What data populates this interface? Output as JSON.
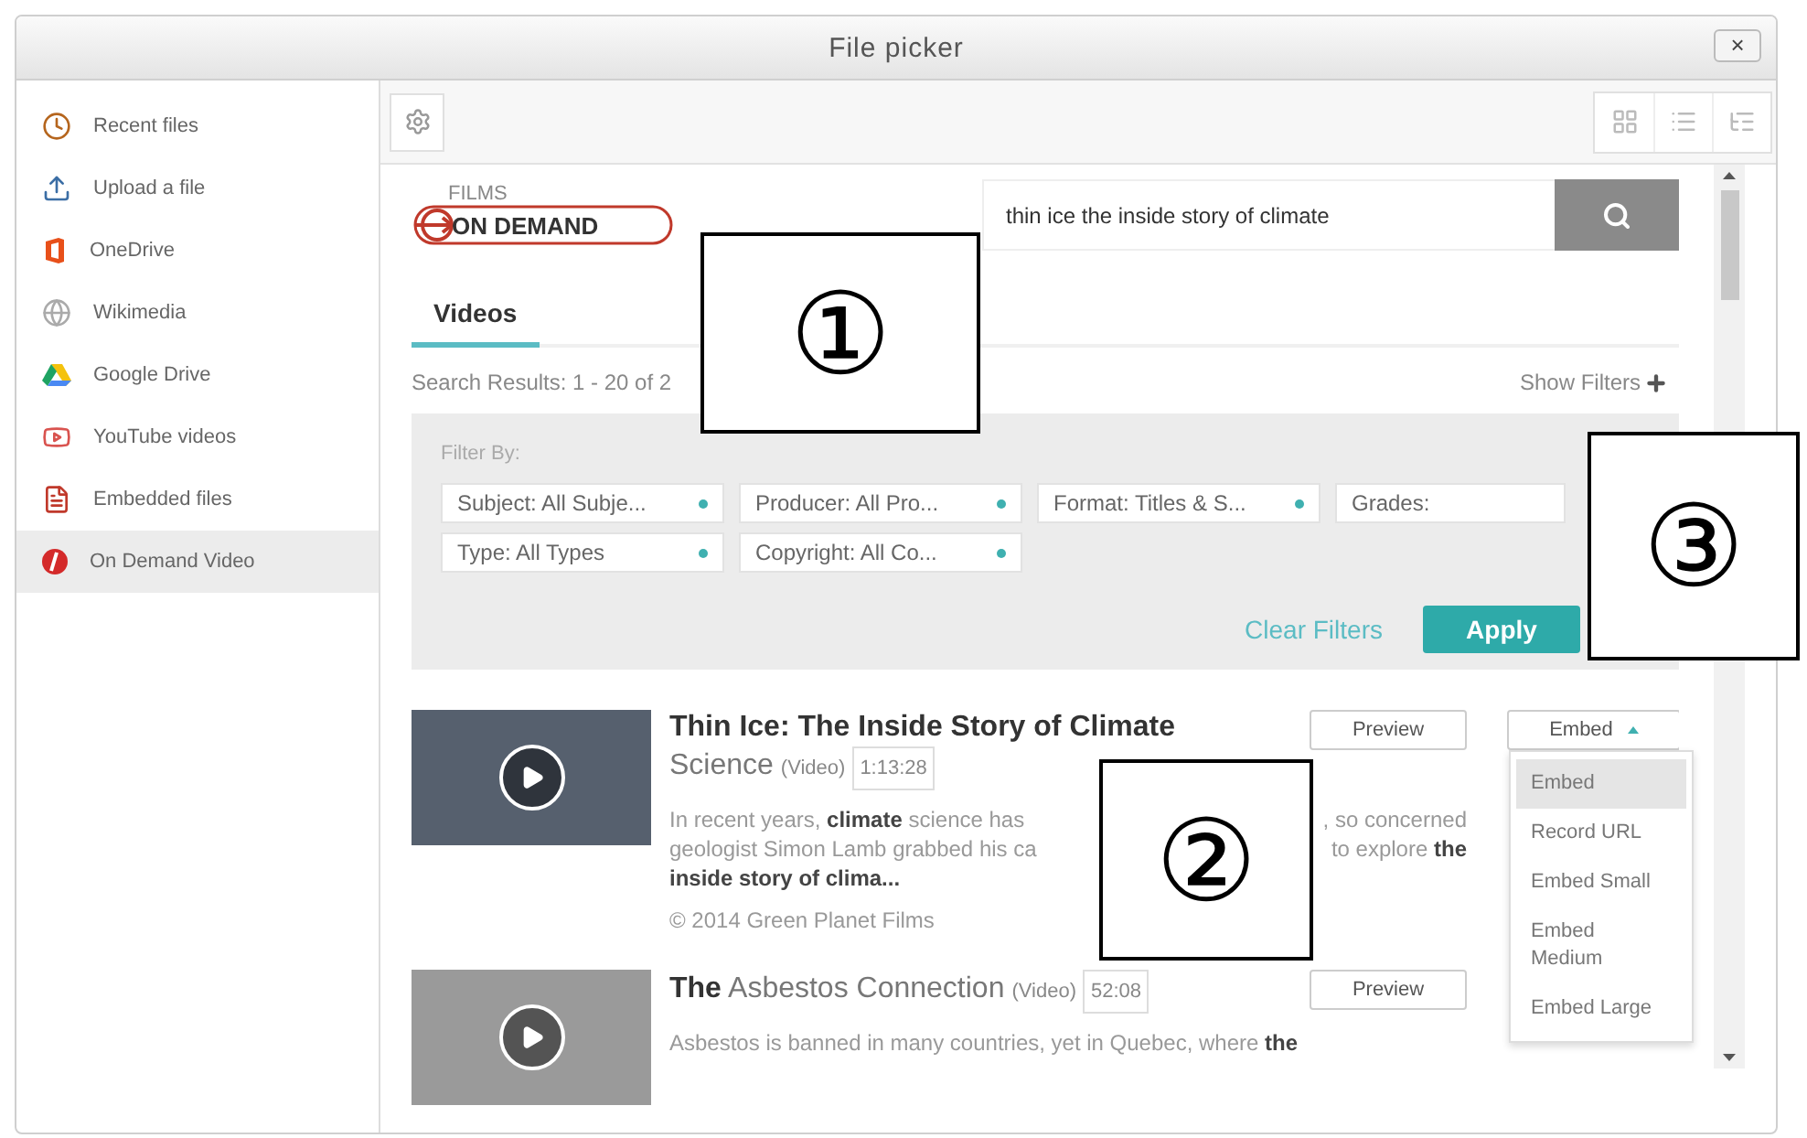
{
  "window": {
    "title": "File picker",
    "close": "×"
  },
  "sidebar": {
    "items": [
      {
        "label": "Recent files",
        "selected": false
      },
      {
        "label": "Upload a file",
        "selected": false
      },
      {
        "label": "OneDrive",
        "selected": false
      },
      {
        "label": "Wikimedia",
        "selected": false
      },
      {
        "label": "Google Drive",
        "selected": false
      },
      {
        "label": "YouTube videos",
        "selected": false
      },
      {
        "label": "Embedded files",
        "selected": false
      },
      {
        "label": "On Demand Video",
        "selected": true
      }
    ]
  },
  "logo": {
    "top": "FILMS",
    "bottom": "ON DEMAND"
  },
  "search": {
    "value": "thin ice the inside story of climate"
  },
  "tabs": [
    {
      "label": "Videos",
      "selected": true
    }
  ],
  "results_summary": "Search Results: 1 - 20 of 2",
  "show_filters": "Show Filters",
  "filters": {
    "heading": "Filter By:",
    "dropdowns": [
      {
        "label": "Subject: All Subje...",
        "caret": true
      },
      {
        "label": "Producer: All Pro...",
        "caret": true
      },
      {
        "label": "Format: Titles & S...",
        "caret": true
      },
      {
        "label": "Grades:",
        "caret": false
      },
      {
        "label": "Type: All Types",
        "caret": true
      },
      {
        "label": "Copyright: All Co...",
        "caret": true
      }
    ],
    "clear": "Clear Filters",
    "apply": "Apply"
  },
  "results": [
    {
      "title_lines": [
        "**Thin Ice: The Inside Story of Climate**",
        "Science"
      ],
      "type": "(Video)",
      "duration": "1:13:28",
      "preview": "Preview",
      "embed": "Embed",
      "description_lines": [
        [
          "In recent years, **climate** science has",
          ", so concerned"
        ],
        [
          "geologist Simon Lamb grabbed his ca",
          "to explore **the**"
        ],
        [
          "**inside story of clima...**"
        ]
      ],
      "copyright": "© 2014 Green Planet Films"
    },
    {
      "title_lines": [
        "**The** Asbestos Connection"
      ],
      "type": "(Video)",
      "duration": "52:08",
      "preview": "Preview",
      "description_lines": [
        [
          "Asbestos is banned in many countries, yet in Quebec, where **the**"
        ]
      ]
    }
  ],
  "embed_menu": [
    {
      "label": "Embed",
      "selected": true
    },
    {
      "label": "Record URL",
      "selected": false
    },
    {
      "label": "Embed Small",
      "selected": false
    },
    {
      "label": "Embed Medium",
      "selected": false
    },
    {
      "label": "Embed Large",
      "selected": false
    }
  ],
  "callouts": [
    {
      "label": "①"
    },
    {
      "label": "②"
    },
    {
      "label": "③"
    }
  ]
}
